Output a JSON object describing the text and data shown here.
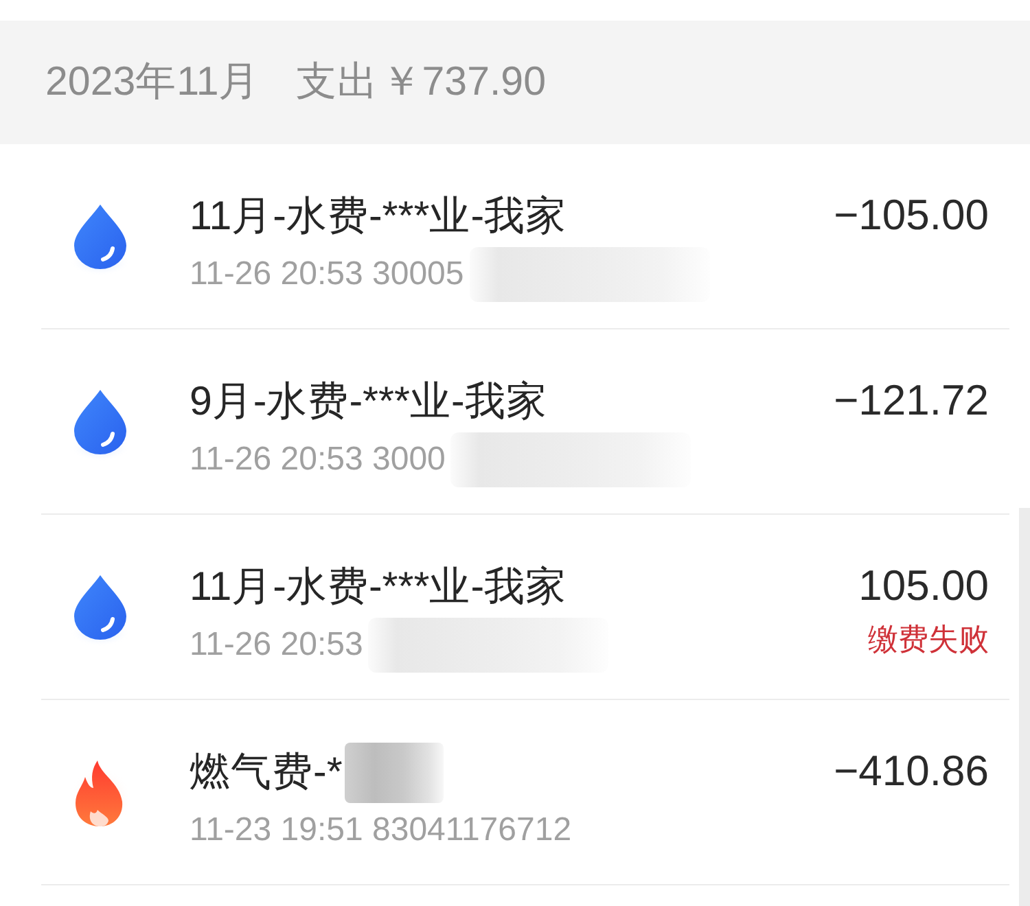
{
  "header": {
    "month": "2023年11月",
    "label": "支出",
    "total": "￥737.90"
  },
  "bills": [
    {
      "kind": "water",
      "title": "11月-水费-***业-我家",
      "title_redacted": false,
      "subtitle": "11-26 20:53 30005",
      "subtitle_redacted": true,
      "amount": "−105.00"
    },
    {
      "kind": "water",
      "title": "9月-水费-***业-我家",
      "title_redacted": false,
      "subtitle": "11-26 20:53 3000",
      "subtitle_redacted": true,
      "amount": "−121.72"
    },
    {
      "kind": "water",
      "title": "11月-水费-***业-我家",
      "title_redacted": false,
      "subtitle": "11-26 20:53",
      "subtitle_redacted": true,
      "amount": "105.00",
      "status": "缴费失败"
    },
    {
      "kind": "gas",
      "title": "燃气费-*",
      "title_redacted": true,
      "subtitle": "11-23 19:51 83041176712",
      "subtitle_redacted": false,
      "amount": "−410.86"
    }
  ]
}
